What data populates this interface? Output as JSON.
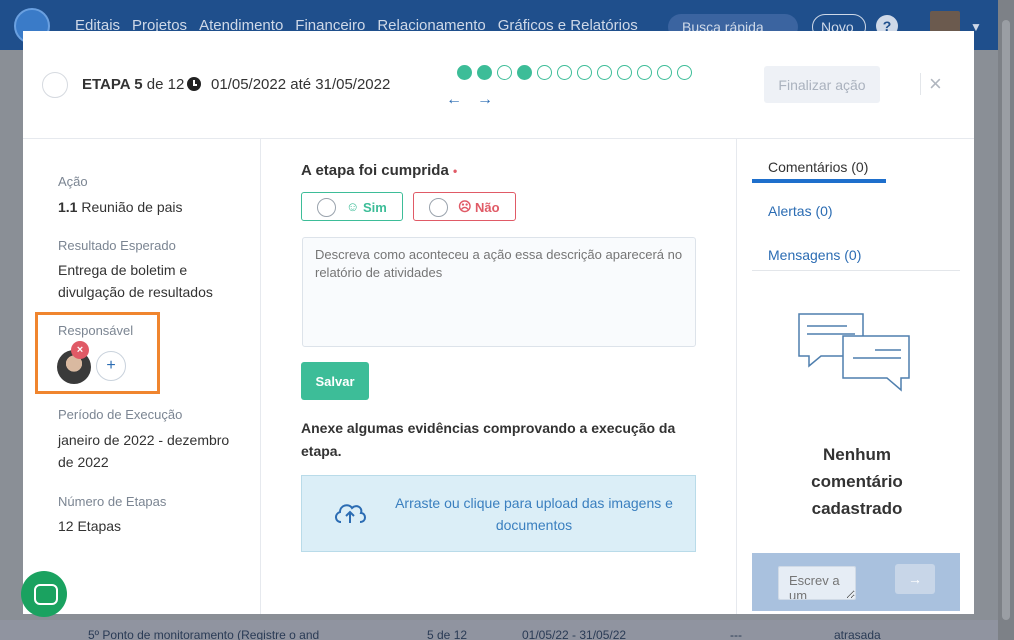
{
  "background": {
    "menu": [
      "Editais",
      "Projetos",
      "Atendimento",
      "Financeiro",
      "Relacionamento",
      "Gráficos e Relatórios"
    ],
    "quick_search": "Busca rápida",
    "new_button": "Novo",
    "help": "?",
    "bottom_row": {
      "item": "5º Ponto de monitoramento (Registre o and",
      "steps": "5 de 12",
      "dates": "01/05/22 - 31/05/22",
      "dash": "---",
      "status": "atrasada"
    }
  },
  "header": {
    "step_prefix": "ETAPA 5",
    "step_suffix": "de 12",
    "date_range": "01/05/2022 até 31/05/2022",
    "steps_total": 12,
    "steps_filled": [
      true,
      true,
      false,
      true,
      false,
      false,
      false,
      false,
      false,
      false,
      false,
      false
    ],
    "prev_arrow": "←",
    "next_arrow": "→",
    "finalize_label": "Finalizar ação",
    "close_label": "×"
  },
  "left": {
    "action_label": "Ação",
    "action_number": "1.1",
    "action_name": "Reunião de pais",
    "expected_label": "Resultado Esperado",
    "expected_value": "Entrega de boletim e divulgação de resultados",
    "responsible_label": "Responsável",
    "add_label": "+",
    "remove_label": "×",
    "period_label": "Período de Execução",
    "period_value": "janeiro de 2022 - dezembro de 2022",
    "steps_label": "Número de Etapas",
    "steps_value": "12 Etapas"
  },
  "middle": {
    "question": "A etapa foi cumprida",
    "required_mark": "•",
    "yes_label": "Sim",
    "no_label": "Não",
    "yes_face": "☺",
    "no_face": "☹",
    "description_placeholder": "Descreva como aconteceu a ação essa descrição aparecerá no relatório de atividades",
    "save_label": "Salvar",
    "evidence_text": "Anexe algumas evidências comprovando a execução da etapa.",
    "upload_text": "Arraste ou clique para upload das imagens e documentos"
  },
  "right": {
    "tabs": [
      {
        "label": "Comentários (0)"
      },
      {
        "label": "Alertas (0)"
      },
      {
        "label": "Mensagens (0)"
      }
    ],
    "empty_text": "Nenhum comentário cadastrado",
    "comment_placeholder": "Escrev a um",
    "send_arrow": "→"
  },
  "colors": {
    "accent_green": "#3dbd98",
    "danger_red": "#e05a66",
    "link_blue": "#2b6cb3",
    "highlight_orange": "#f0852e"
  }
}
